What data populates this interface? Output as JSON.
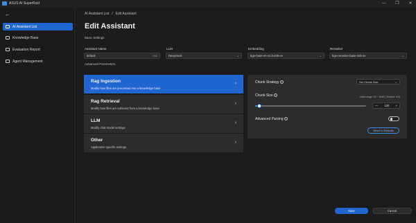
{
  "window": {
    "title": "ASUS AI SuperRcld",
    "controls": [
      "—",
      "❐",
      "✕"
    ]
  },
  "sidebar": {
    "back_icon": "←",
    "items": [
      {
        "label": "AI Assistant List",
        "icon": "list-icon",
        "active": true
      },
      {
        "label": "Knowledge Base",
        "icon": "folder-icon",
        "active": false
      },
      {
        "label": "Evaluation Report",
        "icon": "report-icon",
        "active": false
      },
      {
        "label": "Agent Management",
        "icon": "agent-icon",
        "active": false
      }
    ]
  },
  "breadcrumb": {
    "parent": "AI Assistant List",
    "separator": "/",
    "current": "Edit Assistant"
  },
  "page": {
    "title": "Edit Assistant",
    "basic_settings_label": "Basic Settings",
    "advanced_parameters_label": "Advanced Parameters"
  },
  "basic_fields": {
    "assistant_name": {
      "label": "Assistant Name",
      "value": "default",
      "counter": "7/50"
    },
    "llm": {
      "label": "LLM",
      "value": "DeepSeek"
    },
    "embedding": {
      "label": "Embedding",
      "value": "bge-base-en-v1.5-int8-ov"
    },
    "reranker": {
      "label": "Reranker",
      "value": "bge-reranker-base-int8-ov"
    }
  },
  "param_categories": [
    {
      "title": "Rag Ingestion",
      "desc": "Modify how files are processed into a knowledge base",
      "active": true
    },
    {
      "title": "Rag Retrieval",
      "desc": "Modify how files are retrieved from a knowledge base",
      "active": false
    },
    {
      "title": "LLM",
      "desc": "Modify chat model settings",
      "active": false
    },
    {
      "title": "Other",
      "desc": "Application specific settings",
      "active": false
    }
  ],
  "detail": {
    "chunk_strategy_label": "Chunk Strategy",
    "chunk_strategy_value": "Set Chunk Size",
    "chunk_size_label": "Chunk Size",
    "chunk_size_range": "Valid range: 50 ~ 8000  |  Default: 120",
    "chunk_size_value": "120",
    "chunk_size_min": 50,
    "chunk_size_max": 8000,
    "stepper_minus": "—",
    "stepper_plus": "+",
    "advanced_parsing_label": "Advanced Parsing",
    "advanced_parsing_enabled": false,
    "reset_label": "Reset to Defaults"
  },
  "footer": {
    "save_label": "Save",
    "cancel_label": "Cancel"
  },
  "colors": {
    "accent": "#1f66d1",
    "background": "#1c1c1c",
    "panel": "#2c2c2c"
  }
}
